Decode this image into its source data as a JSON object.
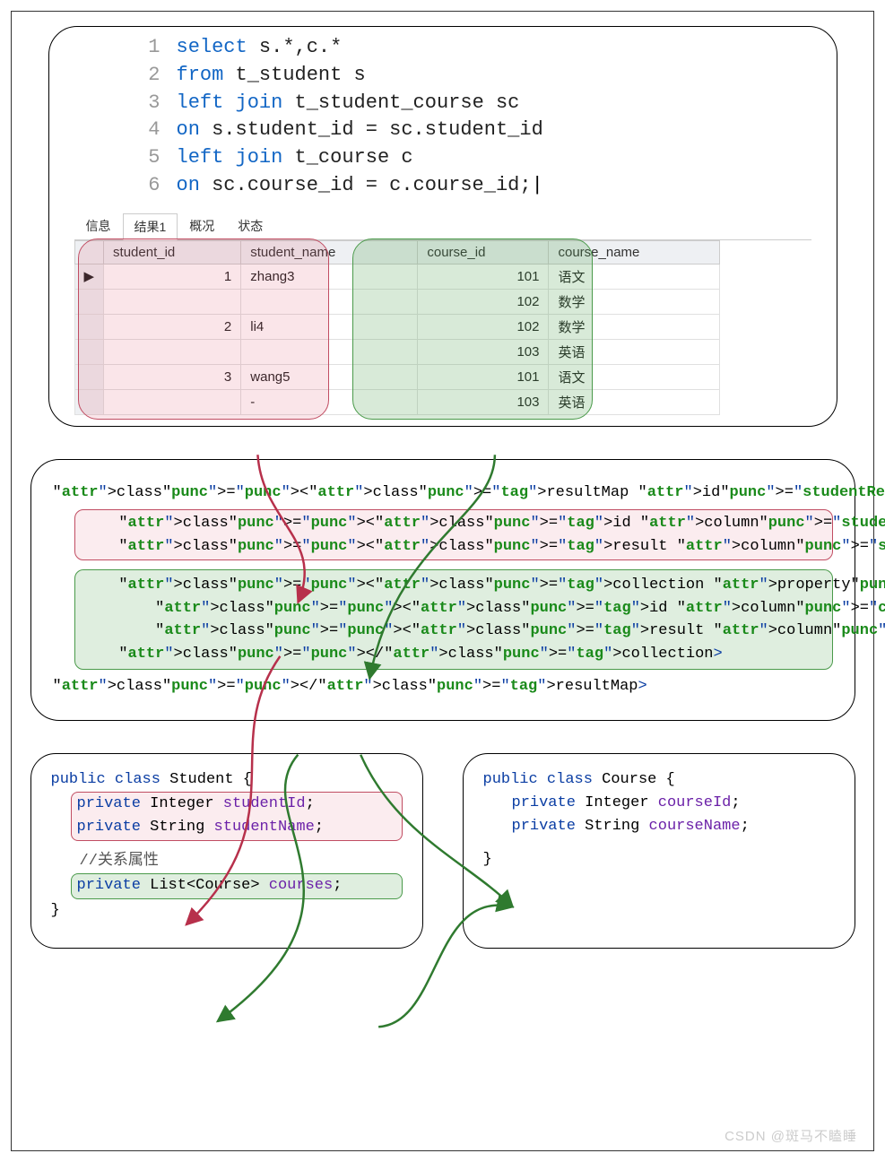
{
  "sql": {
    "lines": [
      {
        "n": "1",
        "tokens": [
          {
            "t": "select ",
            "c": "kw"
          },
          {
            "t": "s.*,c.*",
            "c": "plain"
          }
        ]
      },
      {
        "n": "2",
        "tokens": [
          {
            "t": "from ",
            "c": "kw"
          },
          {
            "t": "t_student s",
            "c": "plain"
          }
        ]
      },
      {
        "n": "3",
        "tokens": [
          {
            "t": "left join ",
            "c": "kw"
          },
          {
            "t": "t_student_course sc",
            "c": "plain"
          }
        ]
      },
      {
        "n": "4",
        "tokens": [
          {
            "t": "on ",
            "c": "kw"
          },
          {
            "t": "s.student_id = sc.student_id",
            "c": "plain"
          }
        ]
      },
      {
        "n": "5",
        "tokens": [
          {
            "t": "left join ",
            "c": "kw"
          },
          {
            "t": "t_course c",
            "c": "plain"
          }
        ]
      },
      {
        "n": "6",
        "tokens": [
          {
            "t": "on ",
            "c": "kw"
          },
          {
            "t": "sc.course_id = c.course_id;",
            "c": "plain cursor"
          }
        ]
      }
    ]
  },
  "tabs": {
    "items": [
      "信息",
      "结果1",
      "概况",
      "状态"
    ],
    "active": 1
  },
  "table": {
    "headers": [
      "student_id",
      "student_name",
      "course_id",
      "course_name"
    ],
    "rows": [
      {
        "ptr": "▶",
        "sid": "1",
        "sname": "zhang3",
        "cid": "101",
        "cname": "语文"
      },
      {
        "ptr": "",
        "sid": "",
        "sname": "",
        "cid": "102",
        "cname": "数学"
      },
      {
        "ptr": "",
        "sid": "2",
        "sname": "li4",
        "cid": "102",
        "cname": "数学"
      },
      {
        "ptr": "",
        "sid": "",
        "sname": "",
        "cid": "103",
        "cname": "英语"
      },
      {
        "ptr": "",
        "sid": "3",
        "sname": "wang5",
        "cid": "101",
        "cname": "语文"
      },
      {
        "ptr": "",
        "sid": "",
        "sname": "-",
        "cid": "103",
        "cname": "英语"
      }
    ]
  },
  "xml": {
    "open": "<resultMap id=\"studentResultMap\" type=\"student\">",
    "id_line": "    <id column=\"student_id\" property=\"studentId\"/>",
    "res_line": "    <result column=\"student_name\" property=\"studentName\"/>",
    "coll_open": "    <collection property=\"courses\" ofType=\"course\">",
    "coll_id": "        <id column=\"course_id\" property=\"courseId\"/>",
    "coll_res": "        <result column=\"course_name\" property=\"courseName\"/>",
    "coll_close": "    </collection>",
    "close": "</resultMap>"
  },
  "student_class": {
    "decl": "public class Student {",
    "f1": "private Integer studentId;",
    "f2": "private String studentName;",
    "cmt": "//关系属性",
    "f3": "private List<Course> courses;",
    "close": "}"
  },
  "course_class": {
    "decl": "public class Course {",
    "f1": "private Integer courseId;",
    "f2": "private String courseName;",
    "close": "}"
  },
  "watermark": "CSDN @斑马不瞌睡"
}
